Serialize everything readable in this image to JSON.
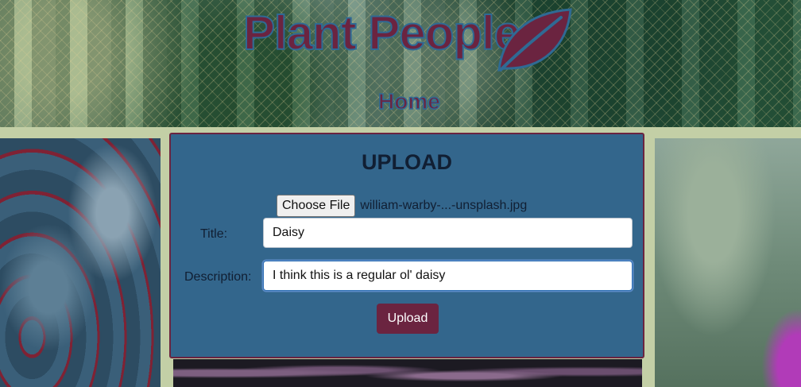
{
  "header": {
    "logo_text": "Plant People",
    "nav_home": "Home"
  },
  "upload_form": {
    "heading": "UPLOAD",
    "file_button_label": "Choose File",
    "file_name": "william-warby-...-unsplash.jpg",
    "title_label": "Title:",
    "title_value": "Daisy",
    "description_label": "Description:",
    "description_value": "I think this is a regular ol' daisy",
    "submit_label": "Upload"
  },
  "colors": {
    "brand": "#6b2440",
    "card_background": "#33668c",
    "page_background": "#c3cfa6"
  },
  "icons": {
    "logo_icon": "leaf-icon"
  }
}
